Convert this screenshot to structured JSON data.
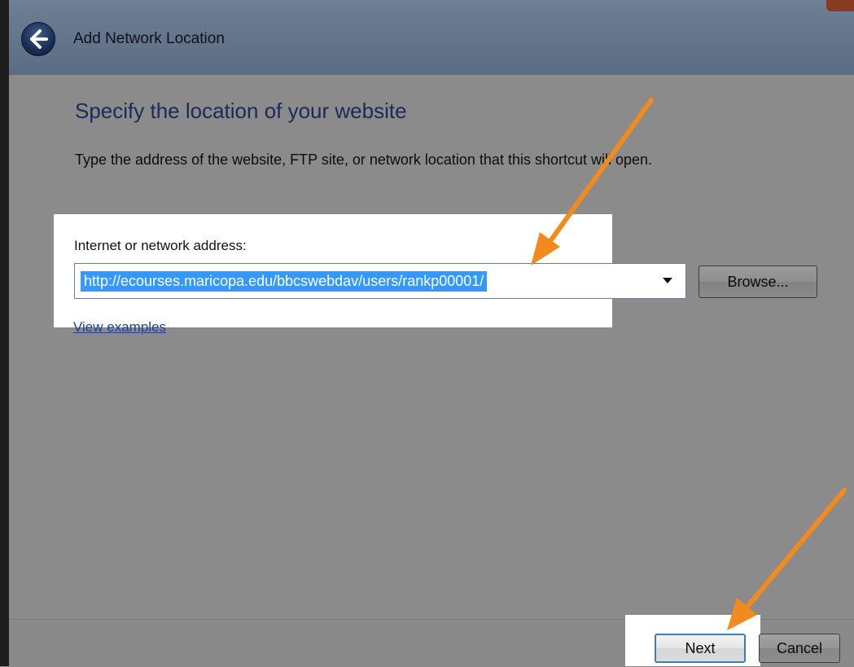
{
  "window": {
    "title": "Add Network Location",
    "back_icon": "back-arrow-icon"
  },
  "page": {
    "heading": "Specify the location of your website",
    "description": "Type the address of the website, FTP site, or network location that this shortcut will open."
  },
  "address": {
    "label": "Internet or network address:",
    "value": "http://ecourses.maricopa.edu/bbcswebdav/users/rankp00001/",
    "dropdown_icon": "chevron-down-icon"
  },
  "buttons": {
    "browse": "Browse...",
    "next": "Next",
    "cancel": "Cancel"
  },
  "links": {
    "view_examples": "View examples"
  },
  "colors": {
    "annotation_arrow": "#f28a1e",
    "selection": "#3399ff",
    "link": "#1d3e9a",
    "heading": "#1a2b5a"
  }
}
